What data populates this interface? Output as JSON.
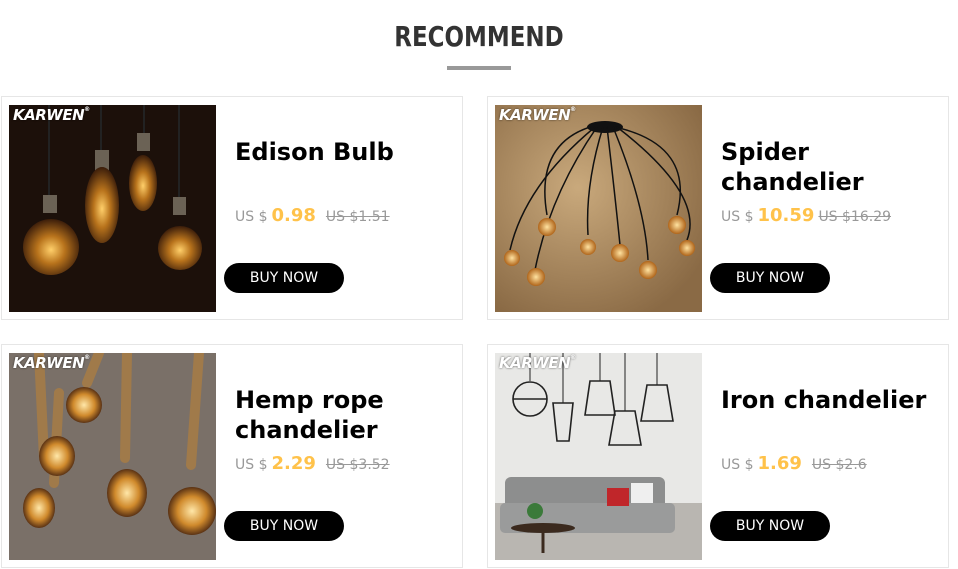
{
  "section": {
    "title": "RECOMMEND"
  },
  "brand": "KARWEN",
  "brand_mark": "®",
  "colors": {
    "price": "#ffc24a",
    "button": "#000000",
    "title": "#333333"
  },
  "products": [
    {
      "name": "Edison Bulb",
      "currency": "US $",
      "price": "0.98",
      "old_price": "US $1.51",
      "button": "BUY NOW"
    },
    {
      "name": "Spider chandelier",
      "currency": "US $",
      "price": "10.59",
      "old_price": "US $16.29",
      "button": "BUY NOW"
    },
    {
      "name": "Hemp rope chandelier",
      "currency": "US $",
      "price": "2.29",
      "old_price": "US $3.52",
      "button": "BUY NOW"
    },
    {
      "name": "Iron chandelier",
      "currency": "US $",
      "price": "1.69",
      "old_price": "US $2.6",
      "button": "BUY NOW"
    }
  ]
}
